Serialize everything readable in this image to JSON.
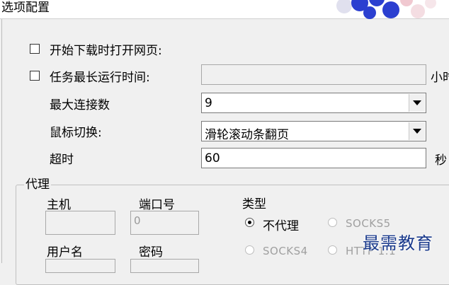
{
  "window": {
    "title": "选项配置"
  },
  "options": {
    "open_page_label": "开始下载时打开网页:",
    "max_runtime_label": "任务最长运行时间:",
    "max_runtime_value": "",
    "max_runtime_unit": "小时",
    "max_conn_label": "最大连接数",
    "max_conn_value": "9",
    "mouse_switch_label": "鼠标切换:",
    "mouse_switch_value": "滑轮滚动条翻页",
    "timeout_label": "超时",
    "timeout_value": "60",
    "timeout_unit": "秒"
  },
  "proxy": {
    "group_label": "代理",
    "host_label": "主机",
    "host_value": "",
    "port_label": "端口号",
    "port_value": "0",
    "type_label": "类型",
    "types": [
      "不代理",
      "SOCKS5",
      "SOCKS4",
      "HTTP 1.1"
    ],
    "selected_type": "不代理",
    "user_label": "用户名",
    "password_label": "密码"
  },
  "watermark": "最需教育"
}
